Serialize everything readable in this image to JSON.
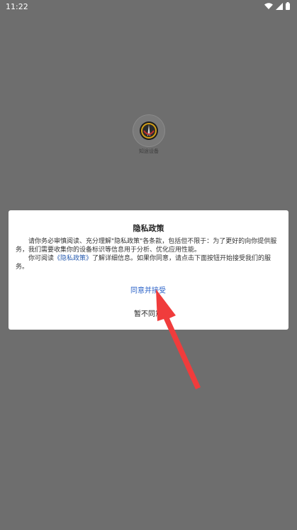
{
  "status_bar": {
    "time": "11:22",
    "icons": [
      "wifi-icon",
      "signal-icon",
      "battery-icon"
    ]
  },
  "background_app": {
    "name": "知途设备"
  },
  "dialog": {
    "title": "隐私政策",
    "body_para1": "请你务必审慎阅读、充分理解\"隐私政策\"各条款，包括但不限于：为了更好的向你提供服务，我们需要收集你的设备标识等信息用于分析、优化应用性能。",
    "body_para2_prefix": "你可阅读",
    "policy_link": "《隐私政策》",
    "body_para2_suffix": "了解详细信息。如果你同意，请点击下面按钮开始接受我们的服务。",
    "agree_label": "同意并接受",
    "disagree_label": "暂不同意"
  },
  "colors": {
    "overlay": "#6e6e6e",
    "link": "#2a5db0",
    "annotation_arrow": "#f03c3c"
  }
}
